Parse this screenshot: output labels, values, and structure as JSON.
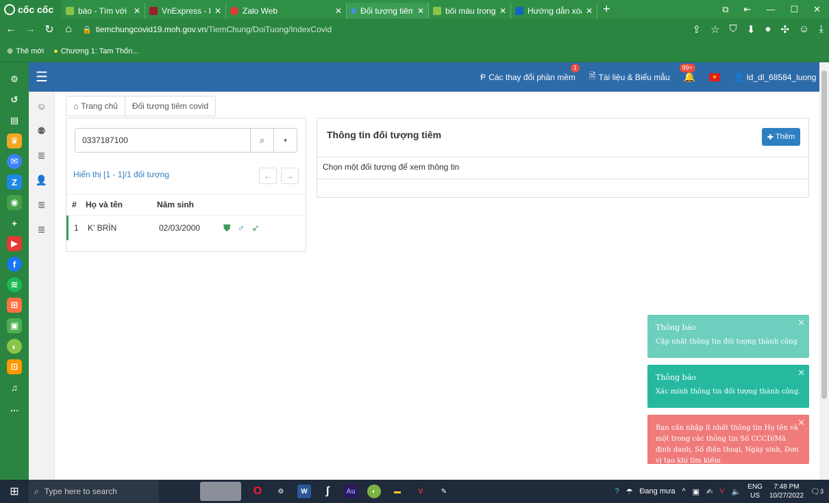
{
  "browser": {
    "brand": "cốc cốc",
    "tabs": [
      {
        "title": "báo - Tìm với Cốc C",
        "icon_color": "#8bc34a",
        "active": false
      },
      {
        "title": "VnExpress - Báo tiến",
        "icon_color": "#9c1f2e",
        "active": false
      },
      {
        "title": "Zalo Web",
        "icon_color": "#e53935",
        "active": false
      },
      {
        "title": "Đối tượng tiêm covi",
        "icon_color": "#4a90d9",
        "active": true
      },
      {
        "title": "bôi màu trong ảnh",
        "icon_color": "#8bc34a",
        "active": false
      },
      {
        "title": "Hướng dẫn xóa chữ",
        "icon_color": "#1565c0",
        "active": false
      }
    ],
    "url_host": "tiemchungcovid19.moh.gov.vn",
    "url_path": "/TiemChung/DoiTuong/IndexCovid",
    "bookmarks": [
      {
        "label": "Thẻ mới"
      },
      {
        "label": "Chương 1: Tam Thốn..."
      }
    ]
  },
  "header": {
    "changes_label": "Các thay đổi phần mềm",
    "changes_badge": "1",
    "docs_label": "Tài liệu & Biểu mẫu",
    "notif_badge": "99+",
    "user": "ld_dl_68584_luong"
  },
  "breadcrumb": {
    "home": "Trang chủ",
    "current": "Đối tượng tiêm covid"
  },
  "search": {
    "value": "0337187100"
  },
  "list": {
    "count_text": "Hiển thị [1 - 1]/1 đối tượng",
    "headers": {
      "idx": "#",
      "name": "Họ và tên",
      "dob": "Năm sinh"
    },
    "rows": [
      {
        "idx": "1",
        "name": "K' BRÌN",
        "dob": "02/03/2000"
      }
    ]
  },
  "detail": {
    "title": "Thông tin đối tượng tiêm",
    "add_label": "Thêm",
    "message": "Chọn một đối tượng để xem thông tin"
  },
  "toasts": [
    {
      "title": "Thông báo",
      "body": "Cập nhật thông tin đối tượng thành công",
      "color": "#5ecab6"
    },
    {
      "title": "Thông báo",
      "body": "Xác minh thông tin đối tượng thành công.",
      "color": "#26b9a0"
    },
    {
      "title": "",
      "body": "Bạn cần nhập ít nhất thông tin Họ tên và một trong các thông tin Số CCCD/Mã định danh, Số điện thoại, Ngày sinh, Đơn vị tạo khi tìm kiếm",
      "color": "#ef7b7b"
    }
  ],
  "taskbar": {
    "search_placeholder": "Type here to search",
    "weather": "Đang mưa",
    "lang_top": "ENG",
    "lang_bottom": "US",
    "time": "7:48 PM",
    "date": "10/27/2022",
    "notif_count": "3"
  },
  "colors": {
    "browser_green": "#2a8540",
    "app_header_blue": "#2d6aa8",
    "accent_blue": "#2d7fc1"
  }
}
